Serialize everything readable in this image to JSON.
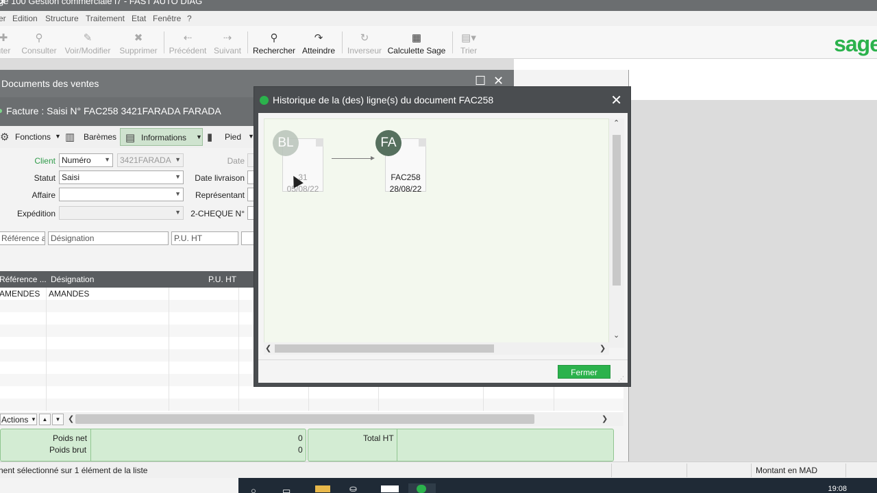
{
  "titlebar": {
    "title": "ge 100 Gestion commerciale i7 - FAST AUTO DIAG",
    "close": "✕"
  },
  "menu": [
    "er",
    "Edition",
    "Structure",
    "Traitement",
    "Etat",
    "Fenêtre",
    "?"
  ],
  "toolbar": {
    "ajouter": "uter",
    "consulter": "Consulter",
    "voir_modifier": "Voir/Modifier",
    "supprimer": "Supprimer",
    "precedent": "Précédent",
    "suivant": "Suivant",
    "rechercher": "Rechercher",
    "atteindre": "Atteindre",
    "inverseur": "Inverseur",
    "calculette": "Calculette Sage",
    "trier": "Trier",
    "logo": "sage"
  },
  "docwin": {
    "title": "Documents des ventes",
    "subtitle": "Facture : Saisi N° FAC258 3421FARADA FARADA",
    "tabs": {
      "fonctions": "Fonctions",
      "baremes": "Barèmes",
      "informations": "Informations",
      "pied": "Pied"
    },
    "fields": {
      "client_label": "Client",
      "client_type": "Numéro",
      "client_value": "3421FARADA",
      "date_label": "Date",
      "statut_label": "Statut",
      "statut_value": "Saisi",
      "date_livraison_label": "Date livraison",
      "affaire_label": "Affaire",
      "representant_label": "Représentant",
      "expedition_label": "Expédition",
      "cheque_label": "2-CHEQUE N°"
    },
    "entry": {
      "reference": "Référence art",
      "designation": "Désignation",
      "pu_ht": "P.U. HT"
    },
    "grid": {
      "headers": [
        "Référence ...",
        "Désignation",
        "P.U. HT"
      ],
      "rows": [
        [
          "AMENDES",
          "AMANDES",
          ""
        ]
      ]
    },
    "actions_label": "Actions",
    "totals": {
      "poids_net_label": "Poids net",
      "poids_net": "0",
      "poids_brut_label": "Poids brut",
      "poids_brut": "0",
      "total_ht_label": "Total HT"
    }
  },
  "status": {
    "left": "nent sélectionné sur 1 élément de la liste",
    "right": "Montant en MAD"
  },
  "taskbar": {
    "time": "19:08"
  },
  "dialog": {
    "title": "Historique de la (des) ligne(s) du document FAC258",
    "nodes": [
      {
        "badge": "BL",
        "number": "31",
        "date": "05/08/22"
      },
      {
        "badge": "FA",
        "number": "FAC258",
        "date": "28/08/22"
      }
    ],
    "close_button": "Fermer"
  },
  "colors": {
    "accent": "#2bb24c",
    "panel_green": "#d3ecd3",
    "title_grey": "#6b6e70"
  }
}
